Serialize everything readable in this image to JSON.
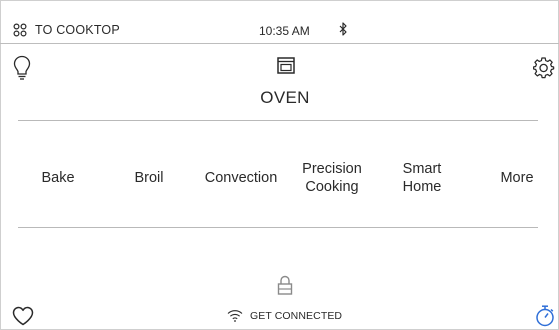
{
  "status_bar": {
    "cooktop_label": "TO COOKTOP",
    "time": "10:35 AM",
    "icons": {
      "cooktop": "cooktop-burners-icon",
      "bluetooth": "bluetooth-icon"
    }
  },
  "header": {
    "title": "OVEN",
    "icons": {
      "light": "light-bulb-icon",
      "oven": "oven-icon",
      "settings": "gear-icon"
    }
  },
  "modes": [
    {
      "id": "bake",
      "label": "Bake"
    },
    {
      "id": "broil",
      "label": "Broil"
    },
    {
      "id": "convection",
      "label": "Convection"
    },
    {
      "id": "precision-cooking",
      "label": "Precision Cooking"
    },
    {
      "id": "smart-home",
      "label": "Smart Home"
    },
    {
      "id": "more",
      "label": "More"
    }
  ],
  "footer": {
    "connect_label": "GET CONNECTED",
    "icons": {
      "favorites": "heart-icon",
      "lock": "lock-icon",
      "wifi": "wifi-icon",
      "timer": "timer-icon"
    }
  },
  "colors": {
    "accent_blue": "#2f6fd8",
    "text": "#2a2a2a",
    "divider": "#b9b9b9"
  }
}
